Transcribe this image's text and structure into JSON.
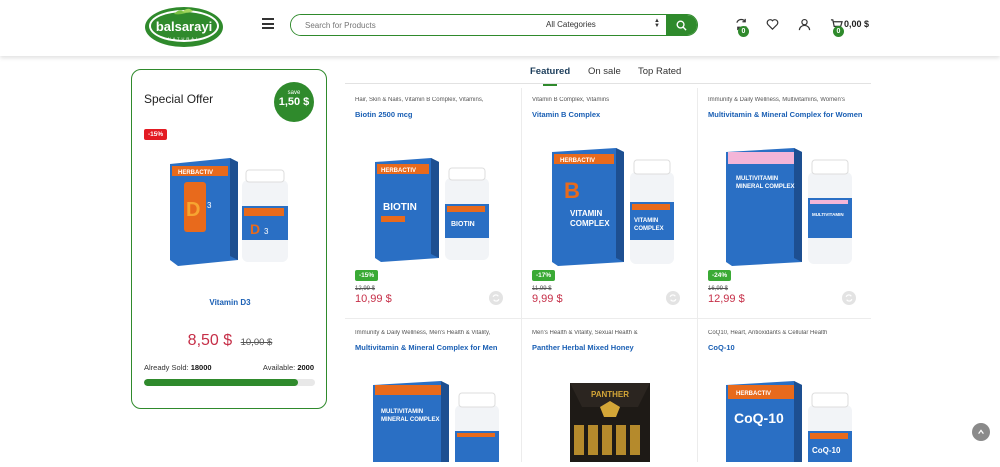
{
  "header": {
    "logo_text": "balsarayi",
    "logo_sub": "NATURAL",
    "search_placeholder": "Search for Products",
    "category_select": "All Categories",
    "compare_count": "0",
    "cart_count": "0",
    "cart_total": "0,00 $"
  },
  "special_offer": {
    "title": "Special Offer",
    "save_label": "save",
    "save_amount": "1,50 $",
    "discount": "-15%",
    "product_name": "Vitamin D3",
    "price": "8,50 $",
    "old_price": "10,00 $",
    "sold_label": "Already Sold:",
    "sold_value": "18000",
    "available_label": "Available:",
    "available_value": "2000",
    "progress": 0.9,
    "box_label": "VITAMIN D3"
  },
  "tabs": [
    "Featured",
    "On sale",
    "Top Rated"
  ],
  "products": [
    {
      "category": "Hair, Skin & Nails, Vitamin B Complex, Vitamins,",
      "name": "Biotin 2500 mcg",
      "discount": "-15%",
      "old_price": "12,99 $",
      "price": "10,99 $",
      "box_label": "BIOTIN"
    },
    {
      "category": "Vitamin B Complex, Vitamins",
      "name": "Vitamin B Complex",
      "discount": "-17%",
      "old_price": "11,99 $",
      "price": "9,99 $",
      "box_label": "VITAMIN COMPLEX"
    },
    {
      "category": "Immunity & Daily Wellness, Multivitamins, Women's",
      "name": "Multivitamin & Mineral Complex for Women",
      "discount": "-24%",
      "old_price": "16,99 $",
      "price": "12,99 $",
      "box_label": "MULTIVITAMIN"
    },
    {
      "category": "Immunity & Daily Wellness, Men's Health & Vitality,",
      "name": "Multivitamin & Mineral Complex for Men",
      "box_label": "MULTIVITAMIN"
    },
    {
      "category": "Men's Health & Vitality, Sexual Health &",
      "name": "Panther Herbal Mixed Honey",
      "box_label": "PANTHER"
    },
    {
      "category": "CoQ10, Heart, Antioxidants & Cellular Health",
      "name": "CoQ-10",
      "box_label": "CoQ-10"
    }
  ],
  "colors": {
    "brand_green": "#2f8a2c",
    "price_red": "#c62f48",
    "link_blue": "#1a5fb4",
    "box_blue": "#2a6fc4",
    "box_orange": "#e86a1c"
  },
  "icons": [
    "menu-icon",
    "search-icon",
    "compare-icon",
    "heart-icon",
    "user-icon",
    "cart-icon",
    "scroll-top-icon"
  ]
}
